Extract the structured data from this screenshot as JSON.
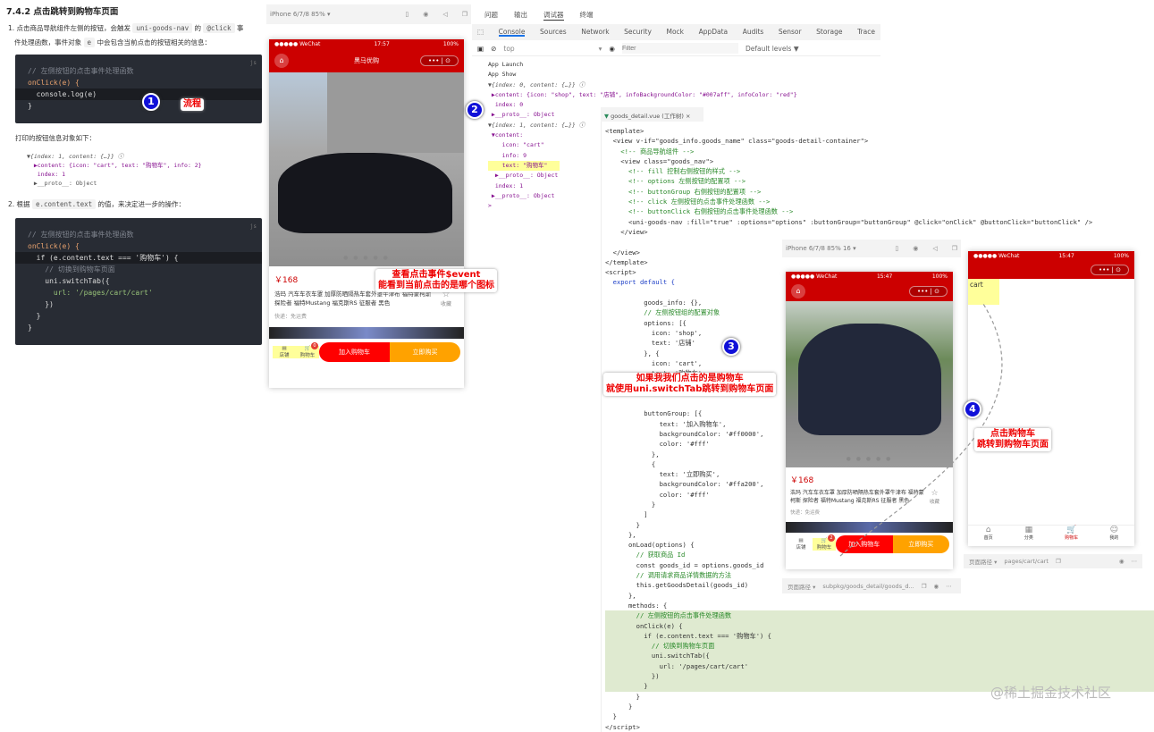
{
  "doc": {
    "heading": "7.4.2 点击跳转到购物车页面",
    "p1_a": "1. 点击商品导航组件左侧的按钮，会触发",
    "p1_code1": "uni-goods-nav",
    "p1_b": "的",
    "p1_code2": "@click",
    "p1_c": "事",
    "p1_d": "件处理函数，事件对象",
    "p1_code3": "e",
    "p1_e": "中会包含当前点击的按钮相关的信息：",
    "code1": {
      "lang": "js",
      "lines": [
        "// 左侧按钮的点击事件处理函数",
        "onClick(e) {",
        "  console.log(e)",
        "}"
      ]
    },
    "printed_label": "打印的按钮信息对象如下：",
    "obj_lines": [
      "▼{index: 1, content: {…}} ⓘ",
      "  ▶content: {icon: \"cart\", text: \"购物车\", info: 2}",
      "   index: 1",
      "  ▶__proto__: Object"
    ],
    "p2_a": "2. 根据",
    "p2_code": "e.content.text",
    "p2_b": "的值，来决定进一步的操作：",
    "code2": {
      "lang": "js",
      "lines": [
        "// 左侧按钮的点击事件处理函数",
        "onClick(e) {",
        "  if (e.content.text === '购物车') {",
        "    // 切换到购物车页面",
        "    uni.switchTab({",
        "      url: '/pages/cart/cart'",
        "    })",
        "  }",
        "}"
      ]
    }
  },
  "sim1": {
    "device": "iPhone 6/7/8 85% ▾",
    "carrier": "●●●●● WeChat",
    "time": "17:57",
    "battery": "100%",
    "nav_title": "黑马优购",
    "capsule": "••• | ⊙",
    "dots": "● ● ● ● ●",
    "price": "￥168",
    "goods_name": "浩玛 汽车车衣车罩 加厚防晒隔热车套外罩牛津布 福特蒙柯斯 探险者 福特Mustang 福克斯RS 征服者 黑色",
    "fav": "收藏",
    "shipping": "快递：免运费",
    "nav_shop": "店铺",
    "nav_cart": "购物车",
    "cart_badge": "0",
    "btn_add": "加入购物车",
    "btn_buy": "立即购买"
  },
  "devtools": {
    "top_tabs": [
      "问题",
      "输出",
      "调试器",
      "终端"
    ],
    "tabs": [
      "Console",
      "Sources",
      "Network",
      "Security",
      "Mock",
      "AppData",
      "Audits",
      "Sensor",
      "Storage",
      "Trace"
    ],
    "active_tab": "Console",
    "context": "top",
    "filter_placeholder": "Filter",
    "levels": "Default levels ▼",
    "console_lines": [
      "App Launch",
      "App Show",
      "▼{index: 0, content: {…}} ⓘ",
      " ▶content: {icon: \"shop\", text: \"店铺\", infoBackgroundColor: \"#007aff\", infoColor: \"red\"}",
      "  index: 0",
      " ▶__proto__: Object",
      "▼{index: 1, content: {…}} ⓘ",
      " ▼content:",
      "    icon: \"cart\"",
      "    info: 9",
      "    text: \"购物车\"",
      "  ▶__proto__: Object",
      "  index: 1",
      " ▶__proto__: Object",
      ">"
    ]
  },
  "editor": {
    "tab_label": "goods_detail.vue (工作树)",
    "lines": [
      [
        "<template>",
        ""
      ],
      [
        "  <view v-if=\"goods_info.goods_name\" class=\"goods-detail-container\">",
        ""
      ],
      [
        "    <!-- 商品导航组件 -->",
        "c"
      ],
      [
        "    <view class=\"goods_nav\">",
        ""
      ],
      [
        "      <!-- fill 控制右侧按钮的样式 -->",
        "c"
      ],
      [
        "      <!-- options 左侧按钮的配置项 -->",
        "c"
      ],
      [
        "      <!-- buttonGroup 右侧按钮的配置项 -->",
        "c"
      ],
      [
        "      <!-- click 左侧按钮的点击事件处理函数 -->",
        "c"
      ],
      [
        "      <!-- buttonClick 右侧按钮的点击事件处理函数 -->",
        "c"
      ],
      [
        "      <uni-goods-nav :fill=\"true\" :options=\"options\" :buttonGroup=\"buttonGroup\" @click=\"onClick\" @buttonClick=\"buttonClick\" />",
        ""
      ],
      [
        "    </view>",
        ""
      ],
      [
        "",
        ""
      ],
      [
        "  </view>",
        ""
      ],
      [
        "</template>",
        ""
      ],
      [
        "<script>",
        ""
      ],
      [
        "  export default {",
        "k"
      ],
      [
        "",
        ""
      ],
      [
        "          goods_info: {},",
        ""
      ],
      [
        "          // 左侧按钮组的配置对象",
        "c"
      ],
      [
        "          options: [{",
        ""
      ],
      [
        "            icon: 'shop',",
        ""
      ],
      [
        "            text: '店铺'",
        ""
      ],
      [
        "          }, {",
        ""
      ],
      [
        "            icon: 'cart',",
        ""
      ],
      [
        "            text: '购物车',",
        ""
      ],
      [
        "",
        ""
      ],
      [
        "",
        ""
      ],
      [
        "",
        ""
      ],
      [
        "          buttonGroup: [{",
        ""
      ],
      [
        "              text: '加入购物车',",
        ""
      ],
      [
        "              backgroundColor: '#ff0000',",
        ""
      ],
      [
        "              color: '#fff'",
        ""
      ],
      [
        "            },",
        ""
      ],
      [
        "            {",
        ""
      ],
      [
        "              text: '立即购买',",
        ""
      ],
      [
        "              backgroundColor: '#ffa200',",
        ""
      ],
      [
        "              color: '#fff'",
        ""
      ],
      [
        "            }",
        ""
      ],
      [
        "          ]",
        ""
      ],
      [
        "        }",
        ""
      ],
      [
        "      },",
        ""
      ],
      [
        "      onLoad(options) {",
        ""
      ],
      [
        "        // 获取商品 Id",
        "c"
      ],
      [
        "        const goods_id = options.goods_id",
        ""
      ],
      [
        "        // 调用请求商品详情数据的方法",
        "c"
      ],
      [
        "        this.getGoodsDetail(goods_id)",
        ""
      ],
      [
        "      },",
        ""
      ],
      [
        "      methods: {",
        ""
      ],
      [
        "        // 左侧按钮的点击事件处理函数",
        "cg"
      ],
      [
        "        onClick(e) {",
        "g"
      ],
      [
        "          if (e.content.text === '购物车') {",
        "g"
      ],
      [
        "            // 切换到购物车页面",
        "cg"
      ],
      [
        "            uni.switchTab({",
        "g"
      ],
      [
        "              url: '/pages/cart/cart'",
        "g"
      ],
      [
        "            })",
        "g"
      ],
      [
        "          }",
        "g"
      ],
      [
        "        }",
        ""
      ],
      [
        "      }",
        ""
      ],
      [
        "  }",
        ""
      ],
      [
        "</script>",
        ""
      ]
    ]
  },
  "sim2": {
    "device": "iPhone 6/7/8 85% 16 ▾",
    "carrier": "●●●●● WeChat",
    "time": "15:47",
    "battery": "100%",
    "capsule": "••• | ⊙",
    "dots": "● ● ● ● ●",
    "price": "￥168",
    "goods_name": "浩玛 汽车车衣车罩 加厚防晒隔热车套外罩牛津布 福特蒙柯斯 探险者 福特Mustang 福克斯RS 征服者 黑色",
    "fav": "收藏",
    "shipping": "快递：免运费",
    "nav_shop": "店铺",
    "nav_cart": "购物车",
    "cart_badge": "2",
    "btn_add": "加入购物车",
    "btn_buy": "立即购买",
    "path_label": "页面路径 ▾",
    "path": "subpkg/goods_detail/goods_d..."
  },
  "sim3": {
    "carrier": "●●●●● WeChat",
    "time": "15:47",
    "battery": "100%",
    "capsule": "••• | ⊙",
    "content": "cart",
    "tabs": [
      "首页",
      "分类",
      "购物车",
      "我的"
    ],
    "active_tab": "购物车",
    "path_label": "页面路径 ▾",
    "path": "pages/cart/cart"
  },
  "annotations": {
    "n1": "1",
    "n1_label": "流程",
    "n2": "2",
    "n2_label": [
      "查看点击事件$event",
      "能看到当前点击的是哪个图标"
    ],
    "n3": "3",
    "n3_label": [
      "如果我我们点击的是购物车",
      "就使用uni.switchTab跳转到购物车页面"
    ],
    "n4": "4",
    "n4_label": [
      "点击购物车",
      "跳转到购物车页面"
    ]
  },
  "watermark": "@稀土掘金技术社区",
  "colors": {
    "brand_red": "#c00000",
    "add_cart": "#ff0000",
    "buy_now": "#ffa200",
    "badge": "#007aff"
  }
}
